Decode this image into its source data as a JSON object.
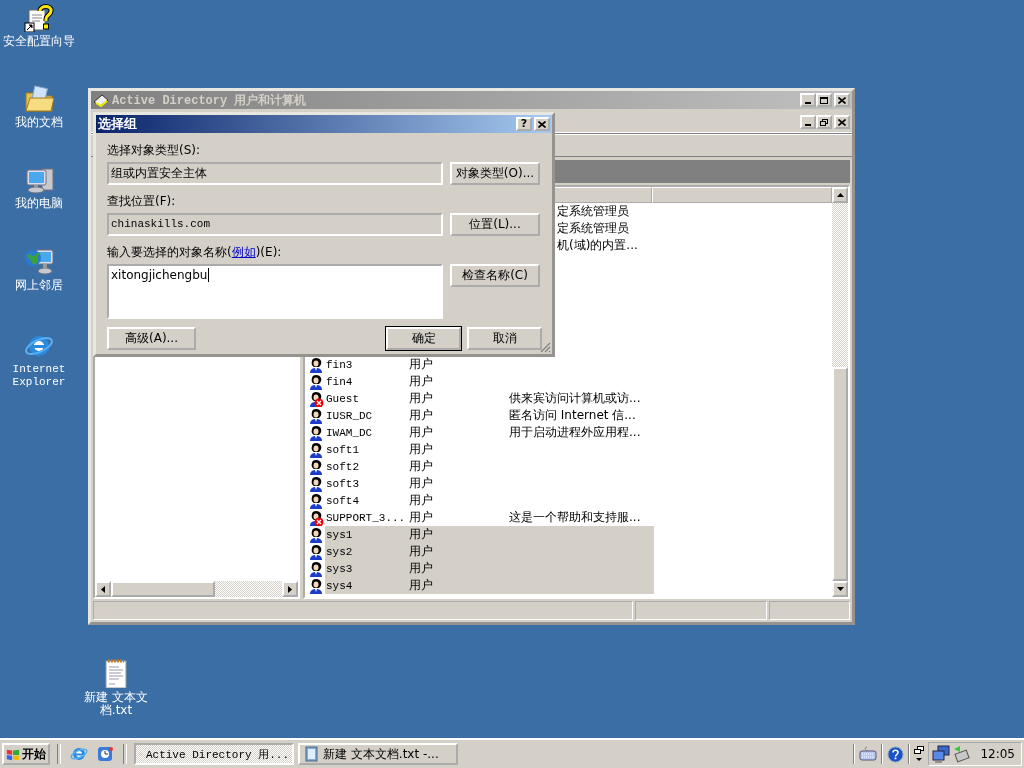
{
  "desktop_icons": [
    {
      "label": "安全配置向导",
      "kind": "wizard"
    },
    {
      "label": "我的文档",
      "kind": "documents"
    },
    {
      "label": "我的电脑",
      "kind": "computer"
    },
    {
      "label": "网上邻居",
      "kind": "network"
    },
    {
      "label": "Internet Explorer",
      "kind": "ie"
    },
    {
      "label": "新建 文本文档.txt",
      "kind": "textfile"
    }
  ],
  "main_window": {
    "title": "Active Directory 用户和计算机",
    "active": false
  },
  "list": {
    "rows": [
      {
        "kind": "covered",
        "description": "定系统管理员"
      },
      {
        "kind": "covered",
        "description": "定系统管理员"
      },
      {
        "kind": "covered",
        "description": "机(域)的内置..."
      },
      {
        "kind": "user",
        "name": "fin3",
        "type": "用户",
        "disabled": false,
        "selected": false
      },
      {
        "kind": "user",
        "name": "fin4",
        "type": "用户",
        "disabled": false,
        "selected": false
      },
      {
        "kind": "user",
        "name": "Guest",
        "type": "用户",
        "description": "供来宾访问计算机或访...",
        "disabled": true,
        "selected": false
      },
      {
        "kind": "user",
        "name": "IUSR_DC",
        "type": "用户",
        "description": "匿名访问 Internet 信...",
        "disabled": false,
        "selected": false
      },
      {
        "kind": "user",
        "name": "IWAM_DC",
        "type": "用户",
        "description": "用于启动进程外应用程...",
        "disabled": false,
        "selected": false
      },
      {
        "kind": "user",
        "name": "soft1",
        "type": "用户",
        "disabled": false,
        "selected": false
      },
      {
        "kind": "user",
        "name": "soft2",
        "type": "用户",
        "disabled": false,
        "selected": false
      },
      {
        "kind": "user",
        "name": "soft3",
        "type": "用户",
        "disabled": false,
        "selected": false
      },
      {
        "kind": "user",
        "name": "soft4",
        "type": "用户",
        "disabled": false,
        "selected": false
      },
      {
        "kind": "user",
        "name": "SUPPORT_3...",
        "type": "用户",
        "description": "这是一个帮助和支持服...",
        "disabled": true,
        "selected": false
      },
      {
        "kind": "user",
        "name": "sys1",
        "type": "用户",
        "disabled": false,
        "selected": true
      },
      {
        "kind": "user",
        "name": "sys2",
        "type": "用户",
        "disabled": false,
        "selected": true
      },
      {
        "kind": "user",
        "name": "sys3",
        "type": "用户",
        "disabled": false,
        "selected": true
      },
      {
        "kind": "user",
        "name": "sys4",
        "type": "用户",
        "disabled": false,
        "selected": true
      }
    ]
  },
  "dialog": {
    "title": "选择组",
    "help_glyph": "?",
    "object_type_label": "选择对象类型(S):",
    "object_type_value": "组或内置安全主体",
    "object_type_button": "对象类型(O)...",
    "location_label": "查找位置(F):",
    "location_value": "chinaskills.com",
    "location_button": "位置(L)...",
    "names_label": {
      "before": "输入要选择的对象名称(",
      "link": "例如",
      "after": ")(E):"
    },
    "names_value": "xitongjichengbu",
    "check_button": "检查名称(C)",
    "advanced_button": "高级(A)...",
    "ok_button": "确定",
    "cancel_button": "取消"
  },
  "taskbar": {
    "start": "开始",
    "tasks": [
      {
        "kind": "ad",
        "label": "Active Directory 用...",
        "selected": true
      },
      {
        "kind": "notepad",
        "label": "新建 文本文档.txt -...",
        "selected": false
      }
    ],
    "clock": "12:05"
  }
}
